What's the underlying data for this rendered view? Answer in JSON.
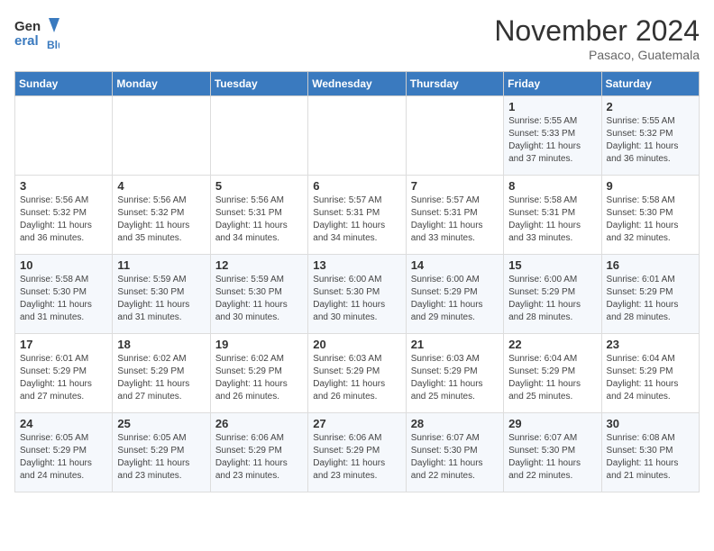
{
  "header": {
    "logo_line1": "General",
    "logo_line2": "Blue",
    "month": "November 2024",
    "location": "Pasaco, Guatemala"
  },
  "days_of_week": [
    "Sunday",
    "Monday",
    "Tuesday",
    "Wednesday",
    "Thursday",
    "Friday",
    "Saturday"
  ],
  "weeks": [
    [
      {
        "day": "",
        "info": ""
      },
      {
        "day": "",
        "info": ""
      },
      {
        "day": "",
        "info": ""
      },
      {
        "day": "",
        "info": ""
      },
      {
        "day": "",
        "info": ""
      },
      {
        "day": "1",
        "info": "Sunrise: 5:55 AM\nSunset: 5:33 PM\nDaylight: 11 hours and 37 minutes."
      },
      {
        "day": "2",
        "info": "Sunrise: 5:55 AM\nSunset: 5:32 PM\nDaylight: 11 hours and 36 minutes."
      }
    ],
    [
      {
        "day": "3",
        "info": "Sunrise: 5:56 AM\nSunset: 5:32 PM\nDaylight: 11 hours and 36 minutes."
      },
      {
        "day": "4",
        "info": "Sunrise: 5:56 AM\nSunset: 5:32 PM\nDaylight: 11 hours and 35 minutes."
      },
      {
        "day": "5",
        "info": "Sunrise: 5:56 AM\nSunset: 5:31 PM\nDaylight: 11 hours and 34 minutes."
      },
      {
        "day": "6",
        "info": "Sunrise: 5:57 AM\nSunset: 5:31 PM\nDaylight: 11 hours and 34 minutes."
      },
      {
        "day": "7",
        "info": "Sunrise: 5:57 AM\nSunset: 5:31 PM\nDaylight: 11 hours and 33 minutes."
      },
      {
        "day": "8",
        "info": "Sunrise: 5:58 AM\nSunset: 5:31 PM\nDaylight: 11 hours and 33 minutes."
      },
      {
        "day": "9",
        "info": "Sunrise: 5:58 AM\nSunset: 5:30 PM\nDaylight: 11 hours and 32 minutes."
      }
    ],
    [
      {
        "day": "10",
        "info": "Sunrise: 5:58 AM\nSunset: 5:30 PM\nDaylight: 11 hours and 31 minutes."
      },
      {
        "day": "11",
        "info": "Sunrise: 5:59 AM\nSunset: 5:30 PM\nDaylight: 11 hours and 31 minutes."
      },
      {
        "day": "12",
        "info": "Sunrise: 5:59 AM\nSunset: 5:30 PM\nDaylight: 11 hours and 30 minutes."
      },
      {
        "day": "13",
        "info": "Sunrise: 6:00 AM\nSunset: 5:30 PM\nDaylight: 11 hours and 30 minutes."
      },
      {
        "day": "14",
        "info": "Sunrise: 6:00 AM\nSunset: 5:29 PM\nDaylight: 11 hours and 29 minutes."
      },
      {
        "day": "15",
        "info": "Sunrise: 6:00 AM\nSunset: 5:29 PM\nDaylight: 11 hours and 28 minutes."
      },
      {
        "day": "16",
        "info": "Sunrise: 6:01 AM\nSunset: 5:29 PM\nDaylight: 11 hours and 28 minutes."
      }
    ],
    [
      {
        "day": "17",
        "info": "Sunrise: 6:01 AM\nSunset: 5:29 PM\nDaylight: 11 hours and 27 minutes."
      },
      {
        "day": "18",
        "info": "Sunrise: 6:02 AM\nSunset: 5:29 PM\nDaylight: 11 hours and 27 minutes."
      },
      {
        "day": "19",
        "info": "Sunrise: 6:02 AM\nSunset: 5:29 PM\nDaylight: 11 hours and 26 minutes."
      },
      {
        "day": "20",
        "info": "Sunrise: 6:03 AM\nSunset: 5:29 PM\nDaylight: 11 hours and 26 minutes."
      },
      {
        "day": "21",
        "info": "Sunrise: 6:03 AM\nSunset: 5:29 PM\nDaylight: 11 hours and 25 minutes."
      },
      {
        "day": "22",
        "info": "Sunrise: 6:04 AM\nSunset: 5:29 PM\nDaylight: 11 hours and 25 minutes."
      },
      {
        "day": "23",
        "info": "Sunrise: 6:04 AM\nSunset: 5:29 PM\nDaylight: 11 hours and 24 minutes."
      }
    ],
    [
      {
        "day": "24",
        "info": "Sunrise: 6:05 AM\nSunset: 5:29 PM\nDaylight: 11 hours and 24 minutes."
      },
      {
        "day": "25",
        "info": "Sunrise: 6:05 AM\nSunset: 5:29 PM\nDaylight: 11 hours and 23 minutes."
      },
      {
        "day": "26",
        "info": "Sunrise: 6:06 AM\nSunset: 5:29 PM\nDaylight: 11 hours and 23 minutes."
      },
      {
        "day": "27",
        "info": "Sunrise: 6:06 AM\nSunset: 5:29 PM\nDaylight: 11 hours and 23 minutes."
      },
      {
        "day": "28",
        "info": "Sunrise: 6:07 AM\nSunset: 5:30 PM\nDaylight: 11 hours and 22 minutes."
      },
      {
        "day": "29",
        "info": "Sunrise: 6:07 AM\nSunset: 5:30 PM\nDaylight: 11 hours and 22 minutes."
      },
      {
        "day": "30",
        "info": "Sunrise: 6:08 AM\nSunset: 5:30 PM\nDaylight: 11 hours and 21 minutes."
      }
    ]
  ]
}
